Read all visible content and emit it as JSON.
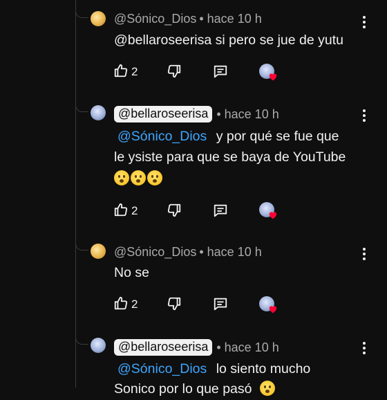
{
  "comments": [
    {
      "author": "@Sónico_Dios",
      "time": "• hace 10 h",
      "mention": "@bellaroseerisa",
      "lines": [
        "si pero se jue de yutu"
      ],
      "likes": "2"
    },
    {
      "author": "@bellaroseerisa",
      "time": "• hace 10 h",
      "mention": "@Sónico_Dios",
      "lines": [
        "y por qué se fue que",
        "le ysiste para que se baya de YouTube"
      ],
      "likes": "2"
    },
    {
      "author": "@Sónico_Dios",
      "time": "• hace 10 h",
      "lines": [
        "No se"
      ],
      "likes": "2"
    },
    {
      "author": "@bellaroseerisa",
      "time": "• hace 10 h",
      "mention": "@Sónico_Dios",
      "lines": [
        "lo siento mucho",
        "Sonico por lo que pasó"
      ]
    }
  ],
  "icons": {
    "like": "thumb-up-icon",
    "dislike": "thumb-down-icon",
    "reply": "comment-reply-icon",
    "more": "more-vertical-icon",
    "heart": "creator-heart-icon"
  },
  "colors": {
    "background": "#0f0f0f",
    "text": "#f1f1f1",
    "meta": "#aaaaaa",
    "mention": "#3ea6ff",
    "heart": "#ff0033"
  }
}
